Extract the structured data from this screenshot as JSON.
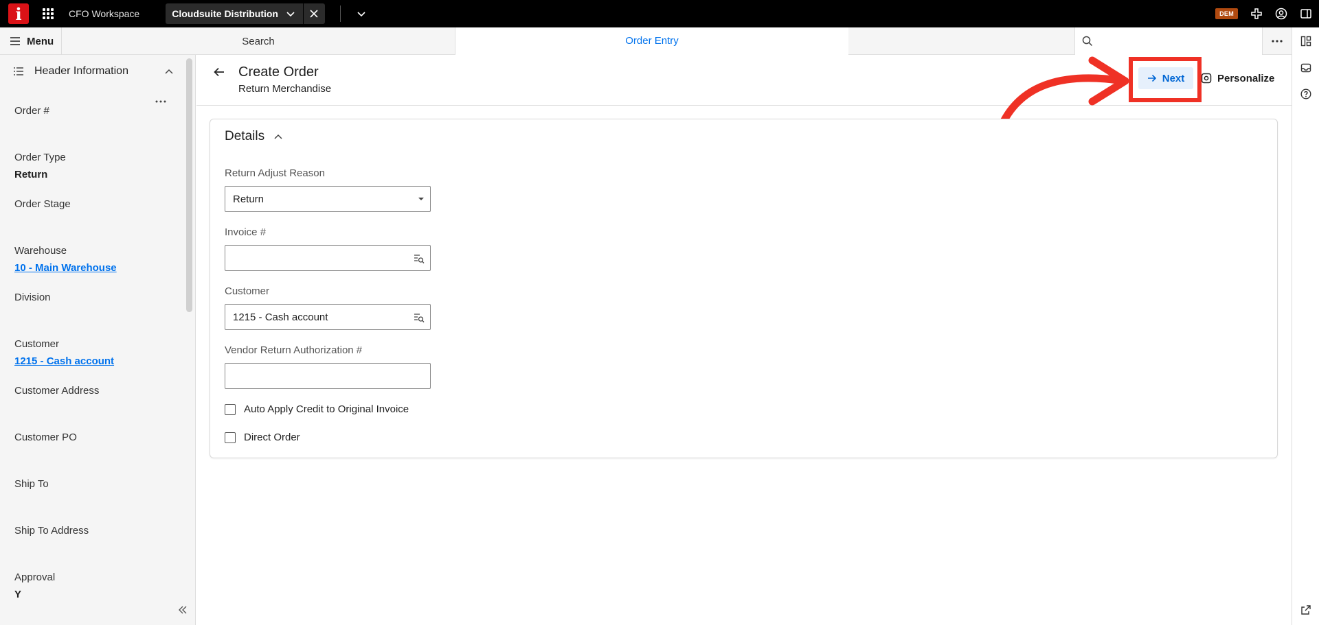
{
  "topbar": {
    "logo_letter": "i",
    "workspace_title": "CFO Workspace",
    "active_tab_label": "Cloudsuite Distribution",
    "env_badge": "DEM"
  },
  "navbar": {
    "menu_label": "Menu",
    "tabs": [
      {
        "label": "Search"
      },
      {
        "label": "Order Entry"
      }
    ]
  },
  "left_panel": {
    "title": "Header Information",
    "fields": [
      {
        "label": "Order #",
        "value": ""
      },
      {
        "label": "Order Type",
        "value": "Return"
      },
      {
        "label": "Order Stage",
        "value": ""
      },
      {
        "label": "Warehouse",
        "value": "10 - Main Warehouse"
      },
      {
        "label": "Division",
        "value": ""
      },
      {
        "label": "Customer",
        "value": "1215 - Cash account"
      },
      {
        "label": "Customer Address",
        "value": ""
      },
      {
        "label": "Customer PO",
        "value": ""
      },
      {
        "label": "Ship To",
        "value": ""
      },
      {
        "label": "Ship To Address",
        "value": ""
      },
      {
        "label": "Approval",
        "value": "Y"
      }
    ]
  },
  "page": {
    "title": "Create Order",
    "subtitle": "Return Merchandise",
    "next_label": "Next",
    "personalize_label": "Personalize"
  },
  "details": {
    "title": "Details",
    "return_adjust_reason": {
      "label": "Return Adjust Reason",
      "value": "Return"
    },
    "invoice": {
      "label": "Invoice #",
      "value": ""
    },
    "customer": {
      "label": "Customer",
      "value": "1215 - Cash account"
    },
    "vendor_rma": {
      "label": "Vendor Return Authorization #",
      "value": ""
    },
    "auto_apply": {
      "label": "Auto Apply Credit to Original Invoice",
      "checked": false
    },
    "direct_order": {
      "label": "Direct Order",
      "checked": false
    }
  },
  "colors": {
    "brand_red": "#da1217",
    "accent_blue": "#0072ed",
    "annotation_red": "#ef3125"
  }
}
